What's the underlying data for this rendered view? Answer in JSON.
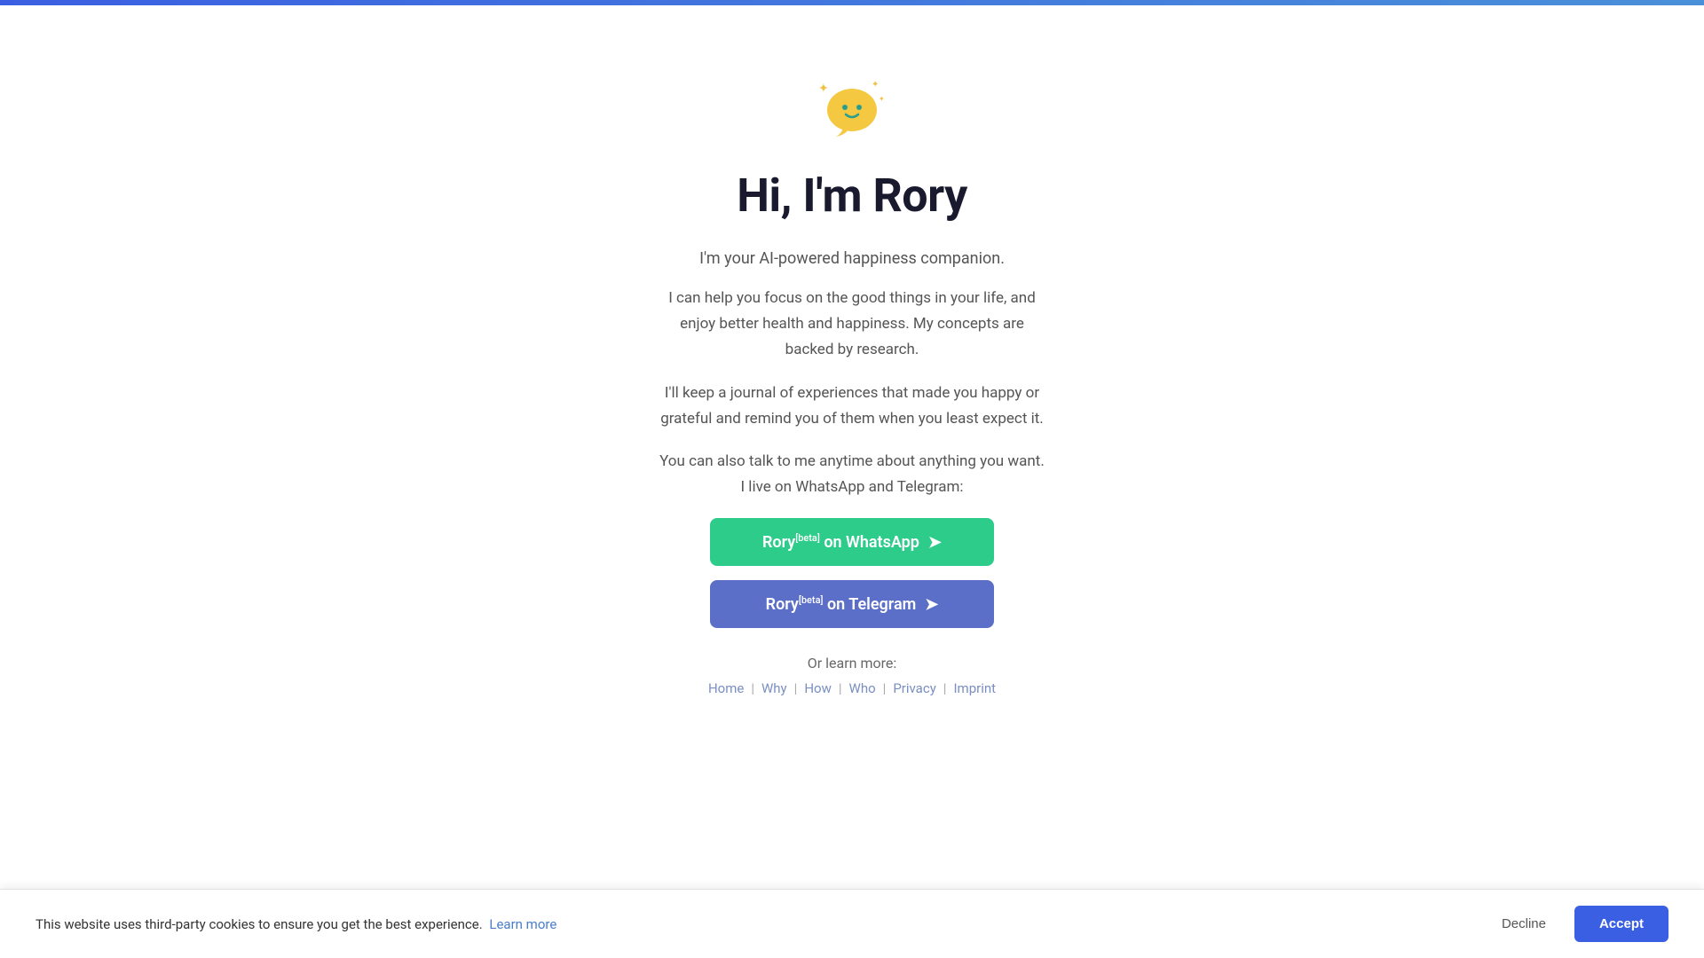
{
  "topbar": {
    "visible": true
  },
  "hero": {
    "title": "Hi, I'm Rory",
    "subtitle": "I'm your AI-powered happiness companion.",
    "description1": "I can help you focus on the good things in your life, and enjoy better health and happiness. My concepts are backed by research.",
    "description2": "I'll keep a journal of experiences that made you happy or grateful and remind you of them when you least expect it.",
    "description3": "You can also talk to me anytime about anything you want. I live on WhatsApp and Telegram:",
    "whatsapp_button": "Rory on WhatsApp",
    "whatsapp_beta": "[beta]",
    "telegram_button": "Rory on Telegram",
    "telegram_beta": "[beta]",
    "or_learn": "Or learn more:",
    "nav": {
      "home": "Home",
      "why": "Why",
      "how": "How",
      "who": "Who",
      "privacy": "Privacy",
      "imprint": "Imprint"
    }
  },
  "cookie": {
    "text": "This website uses third-party cookies to ensure you get the best experience.",
    "learn_more": "Learn more",
    "decline": "Decline",
    "accept": "Accept"
  }
}
